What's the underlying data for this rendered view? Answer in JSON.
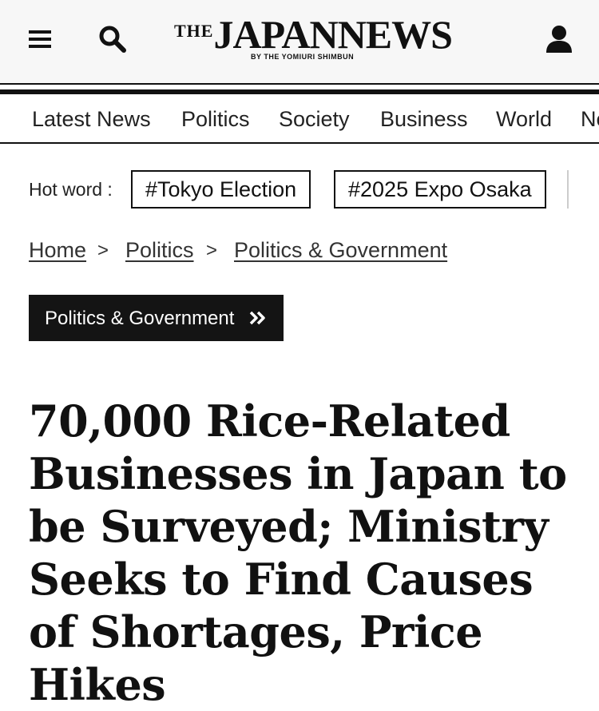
{
  "header": {
    "menu_icon": "hamburger-menu-icon",
    "search_icon": "search-icon",
    "user_icon": "user-account-icon",
    "logo": {
      "the": "THE",
      "japan": "JAPAN",
      "news": "NEWS",
      "subtitle": "BY THE YOMIURI SHIMBUN"
    }
  },
  "nav": {
    "items": [
      "Latest News",
      "Politics",
      "Society",
      "Business",
      "World",
      "Ne"
    ]
  },
  "hot_words": {
    "label": "Hot word :",
    "items": [
      "#Tokyo Election",
      "#2025 Expo Osaka"
    ]
  },
  "breadcrumb": {
    "items": [
      "Home",
      "Politics",
      "Politics & Government"
    ],
    "separator": ">"
  },
  "category": {
    "label": "Politics & Government",
    "icon": "double-chevron-right-icon"
  },
  "article": {
    "headline": "70,000 Rice-Related Businesses in Japan to be Surveyed; Ministry Seeks to Find Causes of Shortages, Price Hikes"
  },
  "colors": {
    "text": "#111111",
    "header_bg": "#f7f7f7",
    "tag_bg": "#141414",
    "tag_text": "#ffffff"
  }
}
